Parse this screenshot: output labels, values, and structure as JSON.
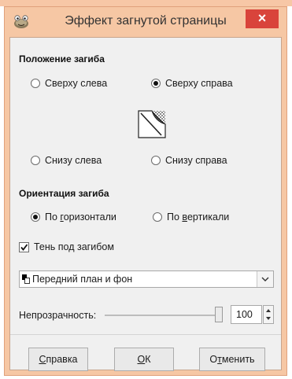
{
  "window": {
    "title": "Эффект загнутой страницы",
    "close_glyph": "×"
  },
  "curl_location": {
    "heading": "Положение загиба",
    "options": [
      {
        "label": "Сверху слева",
        "selected": false
      },
      {
        "label": "Сверху справа",
        "selected": true
      },
      {
        "label": "Снизу слева",
        "selected": false
      },
      {
        "label": "Снизу справа",
        "selected": false
      }
    ],
    "preview_icon": "page-curl-preview-icon"
  },
  "curl_orientation": {
    "heading": "Ориентация загиба",
    "options": [
      {
        "label_pre": "По ",
        "label_ul": "г",
        "label_post": "оризонтали",
        "selected": true
      },
      {
        "label_pre": "По ",
        "label_ul": "в",
        "label_post": "ертикали",
        "selected": false
      }
    ]
  },
  "shadow": {
    "label": "Тень под загибом",
    "checked": true
  },
  "gradient_select": {
    "value": "Передний план и фон"
  },
  "opacity": {
    "label": "Непрозрачность:",
    "value": "100",
    "fraction": 1.0
  },
  "buttons": {
    "help": {
      "pre": "",
      "ul": "С",
      "post": "правка"
    },
    "ok": {
      "pre": "",
      "ul": "О",
      "post": "К"
    },
    "cancel": {
      "pre": "О",
      "ul": "т",
      "post": "менить"
    }
  },
  "colors": {
    "frame": "#f6c7a4",
    "close": "#d9443b",
    "client": "#f0f0f0"
  }
}
